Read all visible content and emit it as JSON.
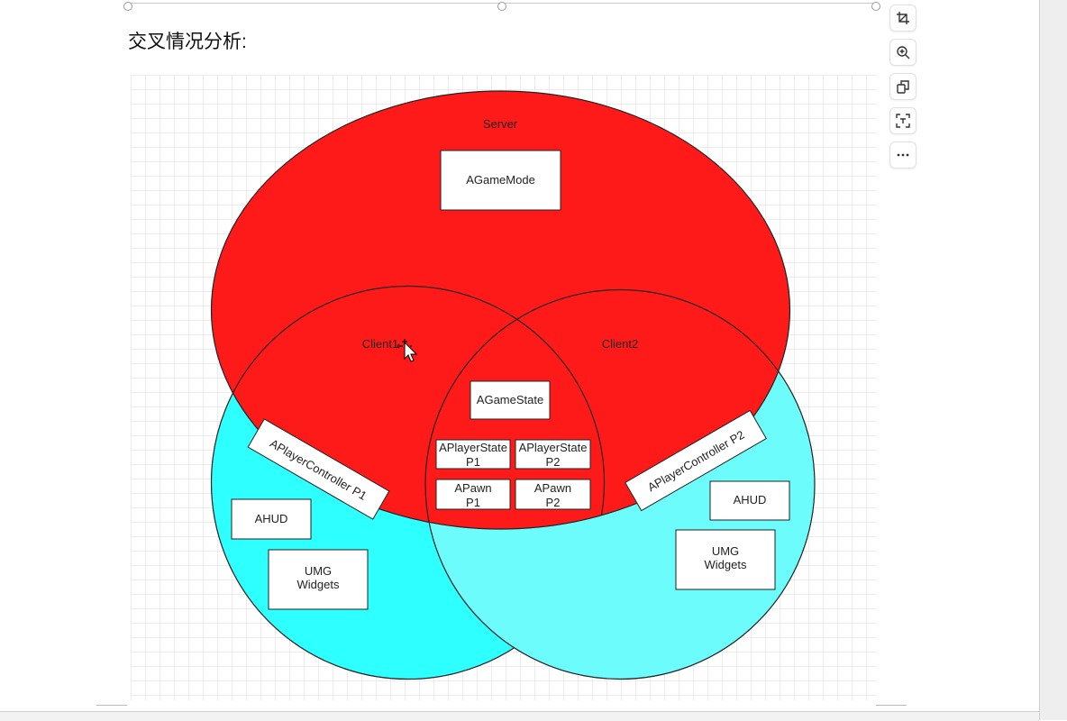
{
  "page": {
    "title": "交叉情况分析:"
  },
  "toolbar": {
    "buttons": [
      {
        "icon": "crop-icon"
      },
      {
        "icon": "zoom-in-icon"
      },
      {
        "icon": "copy-icon"
      },
      {
        "icon": "scan-text-icon"
      },
      {
        "icon": "more-icon"
      }
    ]
  },
  "diagram": {
    "labels": {
      "server": "Server",
      "client1": "Client1",
      "client2": "Client2"
    },
    "boxes": {
      "game_mode": "AGameMode",
      "game_state": "AGameState",
      "player_state_p1_line1": "APlayerState",
      "player_state_p1_line2": "P1",
      "player_state_p2_line1": "APlayerState",
      "player_state_p2_line2": "P2",
      "pawn_p1_line1": "APawn",
      "pawn_p1_line2": "P1",
      "pawn_p2_line1": "APawn",
      "pawn_p2_line2": "P2",
      "controller_p1": "APlayerController P1",
      "controller_p2": "APlayerController P2",
      "hud_left": "AHUD",
      "hud_right": "AHUD",
      "umg_left_line1": "UMG",
      "umg_left_line2": "Widgets",
      "umg_right_line1": "UMG",
      "umg_right_line2": "Widgets"
    },
    "colors": {
      "server": "#ff1a1a",
      "client1": "#2effff",
      "client2": "#6cfcfc",
      "box": "#ffffff",
      "stroke": "#222222"
    }
  }
}
